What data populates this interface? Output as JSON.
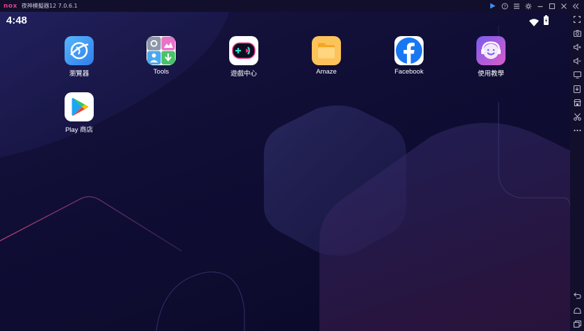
{
  "window": {
    "logo_text": "nox",
    "title": "夜神模擬器12 7.0.6.1",
    "controls": [
      "play-icon",
      "help-icon",
      "menu-icon",
      "settings-icon",
      "minimize-icon",
      "maximize-icon",
      "close-icon",
      "collapse-icon"
    ]
  },
  "statusbar": {
    "time": "4:48",
    "icons": [
      "wifi-icon",
      "battery-icon"
    ]
  },
  "apps": [
    {
      "label": "瀏覽器",
      "icon": "browser-icon"
    },
    {
      "label": "Tools",
      "icon": "tools-icon"
    },
    {
      "label": "遊戲中心",
      "icon": "game-center-icon"
    },
    {
      "label": "Amaze",
      "icon": "folder-icon"
    },
    {
      "label": "Facebook",
      "icon": "facebook-icon"
    },
    {
      "label": "使用教學",
      "icon": "tutorial-icon"
    },
    {
      "label": "Play 商店",
      "icon": "play-store-icon"
    }
  ],
  "sidebar": {
    "tools": [
      "fullscreen-icon",
      "screenshot-icon",
      "volume-up-icon",
      "volume-down-icon",
      "screen-icon",
      "install-apk-icon",
      "shop-icon",
      "cut-icon",
      "more-icon"
    ],
    "nav": [
      "back-icon",
      "home-icon",
      "recents-icon"
    ]
  },
  "colors": {
    "background": "#0c0b2a",
    "titlebar": "#110f2b",
    "logo": "#e0428a",
    "facebook": "#1877f2",
    "folder": "#f5a623"
  }
}
